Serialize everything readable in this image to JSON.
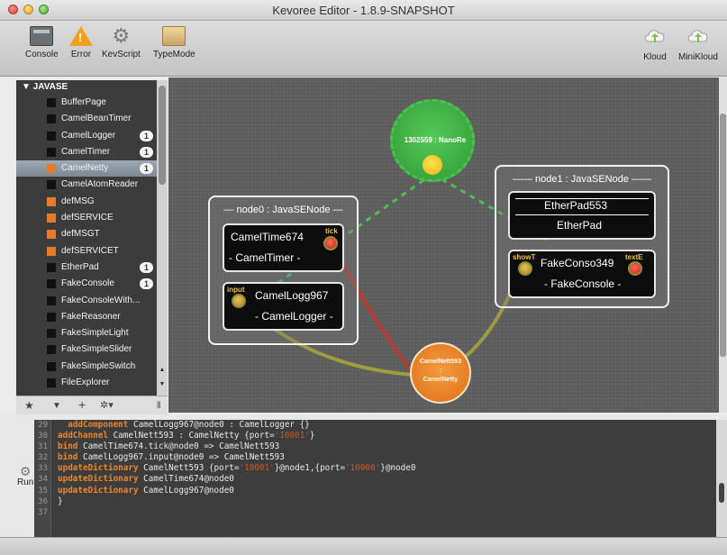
{
  "window": {
    "title": "Kevoree Editor - 1.8.9-SNAPSHOT"
  },
  "toolbar": {
    "left": [
      {
        "label": "Console",
        "icon": "console-icon"
      },
      {
        "label": "Error",
        "icon": "warning-icon"
      },
      {
        "label": "KevScript",
        "icon": "gear-icon"
      },
      {
        "label": "TypeMode",
        "icon": "box-icon"
      }
    ],
    "right": [
      {
        "label": "Kloud",
        "icon": "cloud-upload-icon"
      },
      {
        "label": "MiniKloud",
        "icon": "cloud-upload-icon"
      }
    ]
  },
  "sidebar": {
    "header": "▼ JAVASE",
    "items": [
      {
        "label": "BufferPage",
        "color": "black"
      },
      {
        "label": "CamelBeanTimer",
        "color": "black"
      },
      {
        "label": "CamelLogger",
        "color": "black",
        "badge": "1"
      },
      {
        "label": "CamelTimer",
        "color": "black",
        "badge": "1"
      },
      {
        "label": "CamelNetty",
        "color": "orange",
        "badge": "1",
        "selected": true
      },
      {
        "label": "CamelAtomReader",
        "color": "black"
      },
      {
        "label": "defMSG",
        "color": "orange"
      },
      {
        "label": "defSERVICE",
        "color": "orange"
      },
      {
        "label": "defMSGT",
        "color": "orange"
      },
      {
        "label": "defSERVICET",
        "color": "orange"
      },
      {
        "label": "EtherPad",
        "color": "black",
        "badge": "1"
      },
      {
        "label": "FakeConsole",
        "color": "black",
        "badge": "1"
      },
      {
        "label": "FakeConsoleWith...",
        "color": "black"
      },
      {
        "label": "FakeReasoner",
        "color": "black"
      },
      {
        "label": "FakeSimpleLight",
        "color": "black"
      },
      {
        "label": "FakeSimpleSlider",
        "color": "black"
      },
      {
        "label": "FakeSimpleSwitch",
        "color": "black"
      },
      {
        "label": "FileExplorer",
        "color": "black"
      }
    ],
    "tools": {
      "star": "★",
      "filter": "▼",
      "add": "+",
      "settings": "✲▾",
      "resize": "⦀"
    }
  },
  "canvas": {
    "channels": {
      "nano": {
        "label": "1302559 : NanoRe"
      },
      "netty": {
        "label_top": "CamelNett593",
        "label_sep": ":",
        "label_bottom": "CamelNetty"
      }
    },
    "nodes": {
      "node0": {
        "title": "— node0 : JavaSENode —",
        "timer": {
          "name": "CamelTime674",
          "type": "- CamelTimer -",
          "port": "tick"
        },
        "logger": {
          "name": "CamelLogg967",
          "type": "- CamelLogger -",
          "port": "input"
        }
      },
      "node1": {
        "title": "—— node1 : JavaSENode ——",
        "etherpad": {
          "name": "EtherPad553",
          "type": "EtherPad"
        },
        "console": {
          "name": "FakeConso349",
          "type": "- FakeConsole -",
          "port_in": "showT",
          "port_out": "textE"
        }
      }
    }
  },
  "editor": {
    "run_label": "Run",
    "line_numbers": [
      "29",
      "30",
      "31",
      "32",
      "33",
      "34",
      "35",
      "36",
      "37"
    ],
    "lines": [
      [
        {
          "t": "  "
        },
        {
          "t": "addComponent",
          "c": "kw"
        },
        {
          "t": " CamelLogg967@node0 : CamelLogger {}"
        }
      ],
      [
        {
          "t": "addChannel",
          "c": "kw"
        },
        {
          "t": " CamelNett593 : CamelNetty {port="
        },
        {
          "t": "'10001'",
          "c": "str"
        },
        {
          "t": "}"
        }
      ],
      [
        {
          "t": "bind",
          "c": "kw"
        },
        {
          "t": " CamelTime674.tick@node0 => CamelNett593"
        }
      ],
      [
        {
          "t": "bind",
          "c": "kw"
        },
        {
          "t": " CamelLogg967.input@node0 => CamelNett593"
        }
      ],
      [
        {
          "t": "updateDictionary",
          "c": "kw"
        },
        {
          "t": " CamelNett593 {port="
        },
        {
          "t": "'10001'",
          "c": "str"
        },
        {
          "t": "}@node1,{port="
        },
        {
          "t": "'10000'",
          "c": "str"
        },
        {
          "t": "}@node0"
        }
      ],
      [
        {
          "t": "updateDictionary",
          "c": "kw"
        },
        {
          "t": " CamelTime674@node0"
        }
      ],
      [
        {
          "t": "updateDictionary",
          "c": "kw"
        },
        {
          "t": " CamelLogg967@node0"
        }
      ],
      [
        {
          "t": "}"
        }
      ],
      [
        {
          "t": ""
        }
      ]
    ]
  },
  "colors": {
    "keyword": "#e8862e",
    "string": "#c45b2a",
    "channel_green": "#3fb044",
    "channel_orange": "#e87a25",
    "binding_red": "#c0392b",
    "binding_olive": "#a9a63c"
  }
}
